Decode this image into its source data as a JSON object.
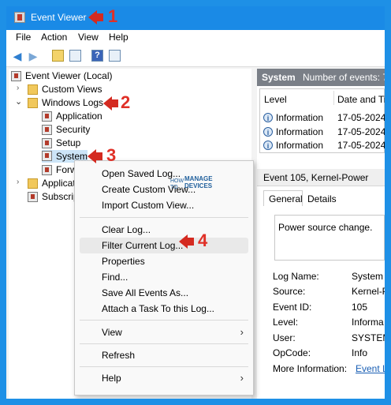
{
  "window": {
    "title": "Event Viewer"
  },
  "menu": {
    "file": "File",
    "action": "Action",
    "view": "View",
    "help": "Help"
  },
  "tree": {
    "root": "Event Viewer (Local)",
    "custom_views": "Custom Views",
    "windows_logs": "Windows Logs",
    "application": "Application",
    "security": "Security",
    "setup": "Setup",
    "system": "System",
    "forwarded": "Forw",
    "apps_services": "Applicati",
    "subscriptions": "Subscrip"
  },
  "right": {
    "header_name": "System",
    "header_count": "Number of events: 7,",
    "col_level": "Level",
    "col_date": "Date and Ti",
    "rows": [
      {
        "level": "Information",
        "date": "17-05-2024"
      },
      {
        "level": "Information",
        "date": "17-05-2024"
      },
      {
        "level": "Information",
        "date": "17-05-2024"
      }
    ],
    "detail_title": "Event 105, Kernel-Power",
    "tab_general": "General",
    "tab_details": "Details",
    "message": "Power source change.",
    "fields": [
      {
        "label": "Log Name:",
        "value": "System"
      },
      {
        "label": "Source:",
        "value": "Kernel-P"
      },
      {
        "label": "Event ID:",
        "value": "105"
      },
      {
        "label": "Level:",
        "value": "Informa"
      },
      {
        "label": "User:",
        "value": "SYSTEM"
      },
      {
        "label": "OpCode:",
        "value": "Info"
      },
      {
        "label": "More Information:",
        "value": "Event L"
      }
    ]
  },
  "context_menu": {
    "open_saved": "Open Saved Log...",
    "create_custom": "Create Custom View...",
    "import_custom": "Import Custom View...",
    "clear": "Clear Log...",
    "filter": "Filter Current Log...",
    "properties": "Properties",
    "find": "Find...",
    "save_all": "Save All Events As...",
    "attach_task": "Attach a Task To this Log...",
    "view": "View",
    "refresh": "Refresh",
    "help": "Help"
  },
  "markers": {
    "m1": "1",
    "m2": "2",
    "m3": "3",
    "m4": "4"
  },
  "watermark": {
    "line1": "HOW",
    "line2": "TO",
    "line3": "MANAGE",
    "line4": "DEVICES"
  },
  "colors": {
    "titlebar": "#1a8ae6",
    "accent_red": "#d42a20",
    "header_gray": "#7a7f87"
  }
}
